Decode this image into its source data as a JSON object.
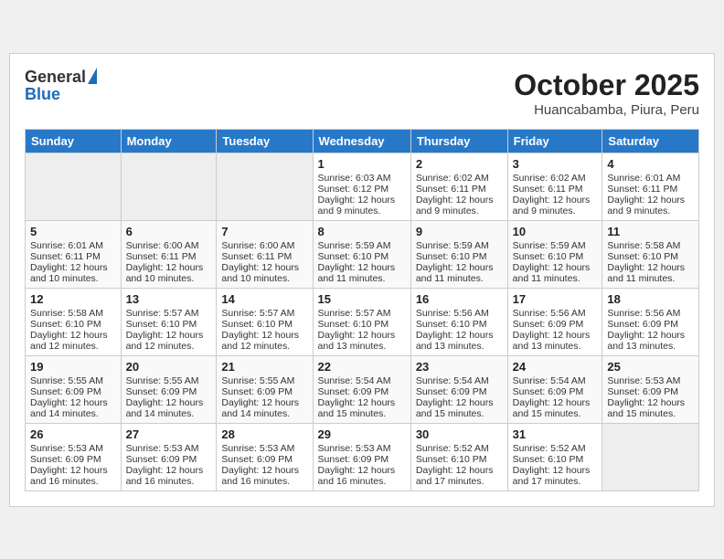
{
  "header": {
    "logo_line1": "General",
    "logo_line2": "Blue",
    "month": "October 2025",
    "location": "Huancabamba, Piura, Peru"
  },
  "weekdays": [
    "Sunday",
    "Monday",
    "Tuesday",
    "Wednesday",
    "Thursday",
    "Friday",
    "Saturday"
  ],
  "weeks": [
    [
      {
        "day": "",
        "empty": true
      },
      {
        "day": "",
        "empty": true
      },
      {
        "day": "",
        "empty": true
      },
      {
        "day": "1",
        "lines": [
          "Sunrise: 6:03 AM",
          "Sunset: 6:12 PM",
          "Daylight: 12 hours",
          "and 9 minutes."
        ]
      },
      {
        "day": "2",
        "lines": [
          "Sunrise: 6:02 AM",
          "Sunset: 6:11 PM",
          "Daylight: 12 hours",
          "and 9 minutes."
        ]
      },
      {
        "day": "3",
        "lines": [
          "Sunrise: 6:02 AM",
          "Sunset: 6:11 PM",
          "Daylight: 12 hours",
          "and 9 minutes."
        ]
      },
      {
        "day": "4",
        "lines": [
          "Sunrise: 6:01 AM",
          "Sunset: 6:11 PM",
          "Daylight: 12 hours",
          "and 9 minutes."
        ]
      }
    ],
    [
      {
        "day": "5",
        "lines": [
          "Sunrise: 6:01 AM",
          "Sunset: 6:11 PM",
          "Daylight: 12 hours",
          "and 10 minutes."
        ]
      },
      {
        "day": "6",
        "lines": [
          "Sunrise: 6:00 AM",
          "Sunset: 6:11 PM",
          "Daylight: 12 hours",
          "and 10 minutes."
        ]
      },
      {
        "day": "7",
        "lines": [
          "Sunrise: 6:00 AM",
          "Sunset: 6:11 PM",
          "Daylight: 12 hours",
          "and 10 minutes."
        ]
      },
      {
        "day": "8",
        "lines": [
          "Sunrise: 5:59 AM",
          "Sunset: 6:10 PM",
          "Daylight: 12 hours",
          "and 11 minutes."
        ]
      },
      {
        "day": "9",
        "lines": [
          "Sunrise: 5:59 AM",
          "Sunset: 6:10 PM",
          "Daylight: 12 hours",
          "and 11 minutes."
        ]
      },
      {
        "day": "10",
        "lines": [
          "Sunrise: 5:59 AM",
          "Sunset: 6:10 PM",
          "Daylight: 12 hours",
          "and 11 minutes."
        ]
      },
      {
        "day": "11",
        "lines": [
          "Sunrise: 5:58 AM",
          "Sunset: 6:10 PM",
          "Daylight: 12 hours",
          "and 11 minutes."
        ]
      }
    ],
    [
      {
        "day": "12",
        "lines": [
          "Sunrise: 5:58 AM",
          "Sunset: 6:10 PM",
          "Daylight: 12 hours",
          "and 12 minutes."
        ]
      },
      {
        "day": "13",
        "lines": [
          "Sunrise: 5:57 AM",
          "Sunset: 6:10 PM",
          "Daylight: 12 hours",
          "and 12 minutes."
        ]
      },
      {
        "day": "14",
        "lines": [
          "Sunrise: 5:57 AM",
          "Sunset: 6:10 PM",
          "Daylight: 12 hours",
          "and 12 minutes."
        ]
      },
      {
        "day": "15",
        "lines": [
          "Sunrise: 5:57 AM",
          "Sunset: 6:10 PM",
          "Daylight: 12 hours",
          "and 13 minutes."
        ]
      },
      {
        "day": "16",
        "lines": [
          "Sunrise: 5:56 AM",
          "Sunset: 6:10 PM",
          "Daylight: 12 hours",
          "and 13 minutes."
        ]
      },
      {
        "day": "17",
        "lines": [
          "Sunrise: 5:56 AM",
          "Sunset: 6:09 PM",
          "Daylight: 12 hours",
          "and 13 minutes."
        ]
      },
      {
        "day": "18",
        "lines": [
          "Sunrise: 5:56 AM",
          "Sunset: 6:09 PM",
          "Daylight: 12 hours",
          "and 13 minutes."
        ]
      }
    ],
    [
      {
        "day": "19",
        "lines": [
          "Sunrise: 5:55 AM",
          "Sunset: 6:09 PM",
          "Daylight: 12 hours",
          "and 14 minutes."
        ]
      },
      {
        "day": "20",
        "lines": [
          "Sunrise: 5:55 AM",
          "Sunset: 6:09 PM",
          "Daylight: 12 hours",
          "and 14 minutes."
        ]
      },
      {
        "day": "21",
        "lines": [
          "Sunrise: 5:55 AM",
          "Sunset: 6:09 PM",
          "Daylight: 12 hours",
          "and 14 minutes."
        ]
      },
      {
        "day": "22",
        "lines": [
          "Sunrise: 5:54 AM",
          "Sunset: 6:09 PM",
          "Daylight: 12 hours",
          "and 15 minutes."
        ]
      },
      {
        "day": "23",
        "lines": [
          "Sunrise: 5:54 AM",
          "Sunset: 6:09 PM",
          "Daylight: 12 hours",
          "and 15 minutes."
        ]
      },
      {
        "day": "24",
        "lines": [
          "Sunrise: 5:54 AM",
          "Sunset: 6:09 PM",
          "Daylight: 12 hours",
          "and 15 minutes."
        ]
      },
      {
        "day": "25",
        "lines": [
          "Sunrise: 5:53 AM",
          "Sunset: 6:09 PM",
          "Daylight: 12 hours",
          "and 15 minutes."
        ]
      }
    ],
    [
      {
        "day": "26",
        "lines": [
          "Sunrise: 5:53 AM",
          "Sunset: 6:09 PM",
          "Daylight: 12 hours",
          "and 16 minutes."
        ]
      },
      {
        "day": "27",
        "lines": [
          "Sunrise: 5:53 AM",
          "Sunset: 6:09 PM",
          "Daylight: 12 hours",
          "and 16 minutes."
        ]
      },
      {
        "day": "28",
        "lines": [
          "Sunrise: 5:53 AM",
          "Sunset: 6:09 PM",
          "Daylight: 12 hours",
          "and 16 minutes."
        ]
      },
      {
        "day": "29",
        "lines": [
          "Sunrise: 5:53 AM",
          "Sunset: 6:09 PM",
          "Daylight: 12 hours",
          "and 16 minutes."
        ]
      },
      {
        "day": "30",
        "lines": [
          "Sunrise: 5:52 AM",
          "Sunset: 6:10 PM",
          "Daylight: 12 hours",
          "and 17 minutes."
        ]
      },
      {
        "day": "31",
        "lines": [
          "Sunrise: 5:52 AM",
          "Sunset: 6:10 PM",
          "Daylight: 12 hours",
          "and 17 minutes."
        ]
      },
      {
        "day": "",
        "empty": true
      }
    ]
  ]
}
